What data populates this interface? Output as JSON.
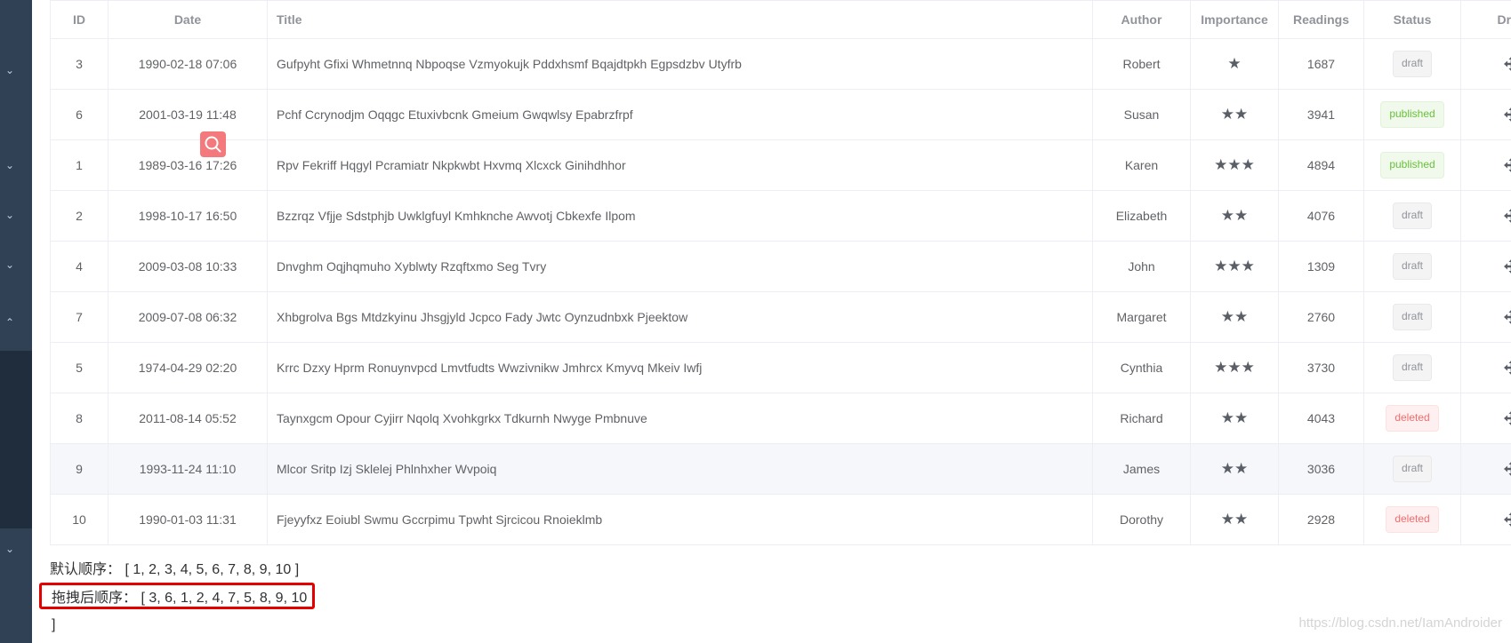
{
  "table": {
    "headers": [
      "ID",
      "Date",
      "Title",
      "Author",
      "Importance",
      "Readings",
      "Status",
      "Drag"
    ],
    "rows": [
      {
        "id": "3",
        "date": "1990-02-18 07:06",
        "title": "Gufpyht Gfixi Whmetnnq Nbpoqse Vzmyokujk Pddxhsmf Bqajdtpkh Egpsdzbv Utyfrb",
        "author": "Robert",
        "importance": 1,
        "readings": "1687",
        "status": "draft"
      },
      {
        "id": "6",
        "date": "2001-03-19 11:48",
        "title": "Pchf Ccrynodjm Oqqgc Etuxivbcnk Gmeium Gwqwlsy Epabrzfrpf",
        "author": "Susan",
        "importance": 2,
        "readings": "3941",
        "status": "published"
      },
      {
        "id": "1",
        "date": "1989-03-16 17:26",
        "title": "Rpv Fekriff Hqgyl Pcramiatr Nkpkwbt Hxvmq Xlcxck Ginihdhhor",
        "author": "Karen",
        "importance": 3,
        "readings": "4894",
        "status": "published"
      },
      {
        "id": "2",
        "date": "1998-10-17 16:50",
        "title": "Bzzrqz Vfjje Sdstphjb Uwklgfuyl Kmhknche Awvotj Cbkexfe Ilpom",
        "author": "Elizabeth",
        "importance": 2,
        "readings": "4076",
        "status": "draft"
      },
      {
        "id": "4",
        "date": "2009-03-08 10:33",
        "title": "Dnvghm Oqjhqmuho Xyblwty Rzqftxmo Seg Tvry",
        "author": "John",
        "importance": 3,
        "readings": "1309",
        "status": "draft"
      },
      {
        "id": "7",
        "date": "2009-07-08 06:32",
        "title": "Xhbgrolva Bgs Mtdzkyinu Jhsgjyld Jcpco Fady Jwtc Oynzudnbxk Pjeektow",
        "author": "Margaret",
        "importance": 2,
        "readings": "2760",
        "status": "draft"
      },
      {
        "id": "5",
        "date": "1974-04-29 02:20",
        "title": "Krrc Dzxy Hprm Ronuynvpcd Lmvtfudts Wwzivnikw Jmhrcx Kmyvq Mkeiv Iwfj",
        "author": "Cynthia",
        "importance": 3,
        "readings": "3730",
        "status": "draft"
      },
      {
        "id": "8",
        "date": "2011-08-14 05:52",
        "title": "Taynxgcm Opour Cyjirr Nqolq Xvohkgrkx Tdkurnh Nwyge Pmbnuve",
        "author": "Richard",
        "importance": 2,
        "readings": "4043",
        "status": "deleted"
      },
      {
        "id": "9",
        "date": "1993-11-24 11:10",
        "title": "Mlcor Sritp Izj Sklelej Phlnhxher Wvpoiq",
        "author": "James",
        "importance": 2,
        "readings": "3036",
        "status": "draft"
      },
      {
        "id": "10",
        "date": "1990-01-03 11:31",
        "title": "Fjeyyfxz Eoiubl Swmu Gccrpimu Tpwht Sjrcicou Rnoieklmb",
        "author": "Dorothy",
        "importance": 2,
        "readings": "2928",
        "status": "deleted"
      }
    ]
  },
  "order": {
    "default_label": "默认顺序：",
    "default_value": "[ 1, 2, 3, 4, 5, 6, 7, 8, 9, 10 ]",
    "after_label": "拖拽后顺序：",
    "after_value": "[ 3, 6, 1, 2, 4, 7, 5, 8, 9, 10 ]"
  },
  "watermark": "https://blog.csdn.net/IamAndroider",
  "colors": {
    "sidebar": "#304156",
    "sidebar_dark": "#1f2d3d",
    "highlight_box": "#e50000",
    "search_button": "#f4797c"
  },
  "icons": {
    "drag": "move-arrows-icon",
    "importance": "star-icon",
    "search": "search-icon",
    "sidebar": "chevron-down-icon"
  }
}
